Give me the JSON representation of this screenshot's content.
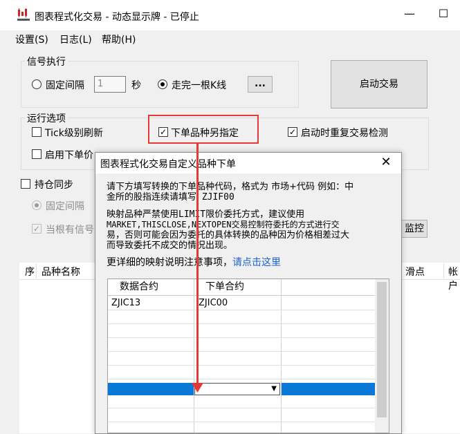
{
  "window": {
    "title": "图表程式化交易 - 动态显示牌 - 已停止",
    "minimize_glyph": "—",
    "maximize_glyph": "☐",
    "app_icon": "chart-app-logo-icon"
  },
  "menu": [
    {
      "label": "设置(S)"
    },
    {
      "label": "日志(L)"
    },
    {
      "label": "帮助(H)"
    }
  ],
  "signal_group": {
    "title": "信号执行",
    "fixed_interval_label": "固定间隔",
    "interval_value": "1",
    "seconds_label": "秒",
    "complete_bar_label": "走完一根K线",
    "more_button_label": "...",
    "selected": "complete_bar"
  },
  "start_button_label": "启动交易",
  "run_group": {
    "title": "运行选项",
    "tick_refresh_label": "Tick级别刷新",
    "tick_refresh_checked": false,
    "alt_symbol_label": "下单品种另指定",
    "alt_symbol_checked": true,
    "startup_check_label": "启动时重复交易检测",
    "startup_check_checked": true,
    "order_price_label": "启用下单价",
    "order_price_checked": false
  },
  "position_sync": {
    "label": "持仓同步",
    "checked": false,
    "fixed_interval_label": "固定间隔",
    "when_signal_label": "当根有信号",
    "monitor_button_label": "监控"
  },
  "bg_table_headers": [
    "序",
    "品种名称",
    "滑点",
    "帐户"
  ],
  "dialog": {
    "title": "图表程式化交易自定义品种下单",
    "close_glyph": "✕",
    "para1_line1": "请下方填写转换的下单品种代码，格式为 市场+代码 例如：中",
    "para1_line2": "金所的股指连续请填写 ZJIF00",
    "para2_line1": "映射品种严禁使用LIMIT限价委托方式，建议使用",
    "para2_line2": "MARKET,THISCLOSE,NEXTOPEN交易控制符委托的方式进行交",
    "para2_line3": "易，否则可能会因为委托的具体转换的品种因为价格相差过大",
    "para2_line4": "而导致委托不成交的情况出现。",
    "more_info_prefix": "更详细的映射说明注意事项，",
    "more_info_link": "请点击这里",
    "grid_headers": [
      "数据合约",
      "下单合约"
    ],
    "rows": [
      {
        "data": "ZJIC13",
        "order": "ZJIC00"
      }
    ],
    "dropdown_glyph": "▼"
  },
  "colors": {
    "highlight_red": "#e53935",
    "selection_blue": "#0a78d7",
    "link_blue": "#1a5fd4"
  }
}
